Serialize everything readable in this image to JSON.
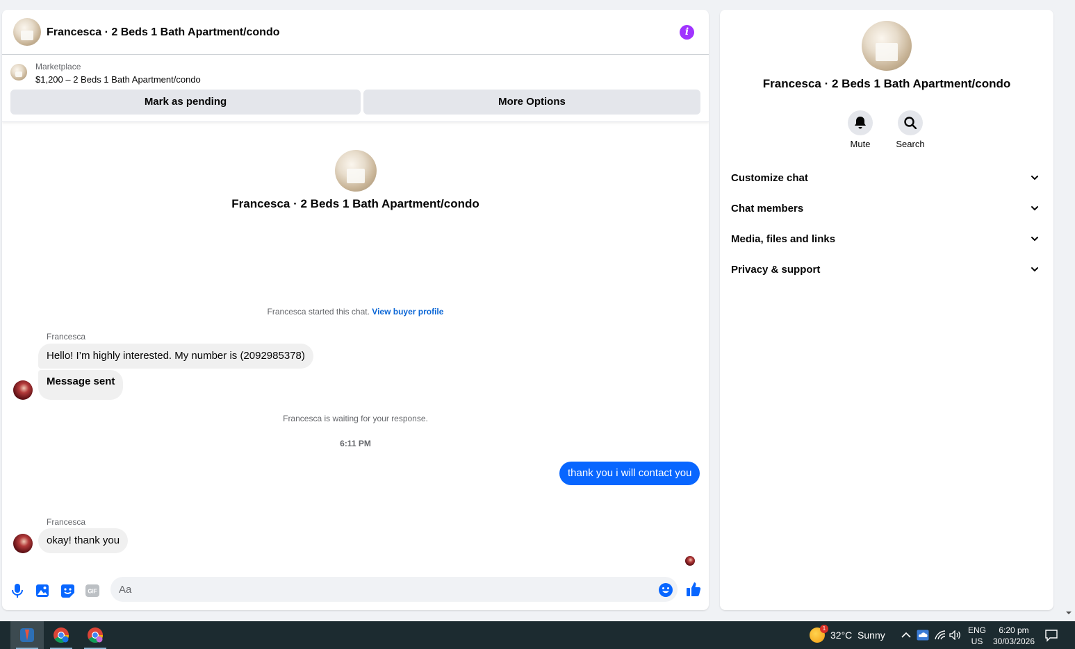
{
  "header": {
    "title": "Francesca · 2 Beds 1 Bath Apartment/condo",
    "info_icon": "info-icon"
  },
  "listing": {
    "kicker": "Marketplace",
    "line": "$1,200 – 2 Beds 1 Bath Apartment/condo",
    "pending_label": "Mark as pending",
    "more_label": "More Options"
  },
  "intro": {
    "title": "Francesca · 2 Beds 1 Bath Apartment/condo"
  },
  "thread": {
    "started_text": "Francesca started this chat.",
    "view_profile": "View buyer profile",
    "sender": "Francesca",
    "msg1": "Hello! I’m highly interested. My number is (2092985378)",
    "msg2": "Message sent",
    "waiting": "Francesca is waiting for your response.",
    "time": "6:11 PM",
    "out1": "thank you i will contact you",
    "sender2": "Francesca",
    "msg3": "okay! thank you"
  },
  "composer": {
    "placeholder": "Aa"
  },
  "details": {
    "title": "Francesca · 2 Beds 1 Bath Apartment/condo",
    "mute_label": "Mute",
    "search_label": "Search",
    "sections": [
      "Customize chat",
      "Chat members",
      "Media, files and links",
      "Privacy & support"
    ]
  },
  "taskbar": {
    "weather_badge": "1",
    "weather": "32°C  Sunny",
    "lang": "ENG",
    "region": "US",
    "time": "6:20 pm",
    "date": "30/03/2026"
  },
  "colors": {
    "accent": "#0866ff",
    "info": "#a033ff",
    "taskbar": "#1c2b30"
  }
}
